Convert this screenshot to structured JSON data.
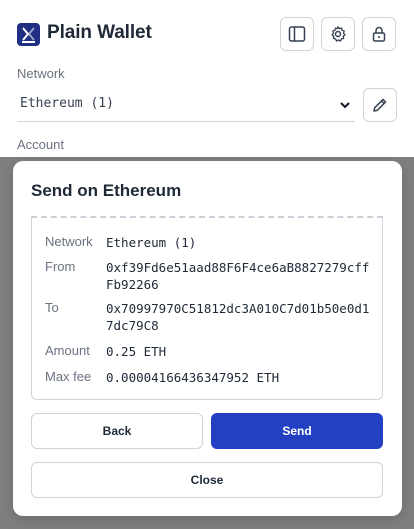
{
  "app": {
    "brand": "Plain Wallet",
    "network_label": "Network",
    "network_value": "Ethereum (1)",
    "account_label": "Account"
  },
  "icons": {
    "logo": "wallet-logo-icon",
    "sidebar": "sidebar-panel-icon",
    "settings": "gear-icon",
    "lock": "lock-icon",
    "chevron": "chevron-down-icon",
    "edit": "pencil-icon"
  },
  "modal": {
    "title": "Send on Ethereum",
    "rows": [
      {
        "label": "Network",
        "value": "Ethereum (1)"
      },
      {
        "label": "From",
        "value": "0xf39Fd6e51aad88F6F4ce6aB8827279cffFb92266"
      },
      {
        "label": "To",
        "value": "0x70997970C51812dc3A010C7d01b50e0d17dc79C8"
      },
      {
        "label": "Amount",
        "value": "0.25 ETH"
      },
      {
        "label": "Max fee",
        "value": "0.00004166436347952 ETH"
      }
    ],
    "back_label": "Back",
    "send_label": "Send",
    "close_label": "Close"
  },
  "colors": {
    "brand": "#1f2f83",
    "primary": "#2340c2",
    "overlay": "rgba(0,0,0,0.5)"
  }
}
